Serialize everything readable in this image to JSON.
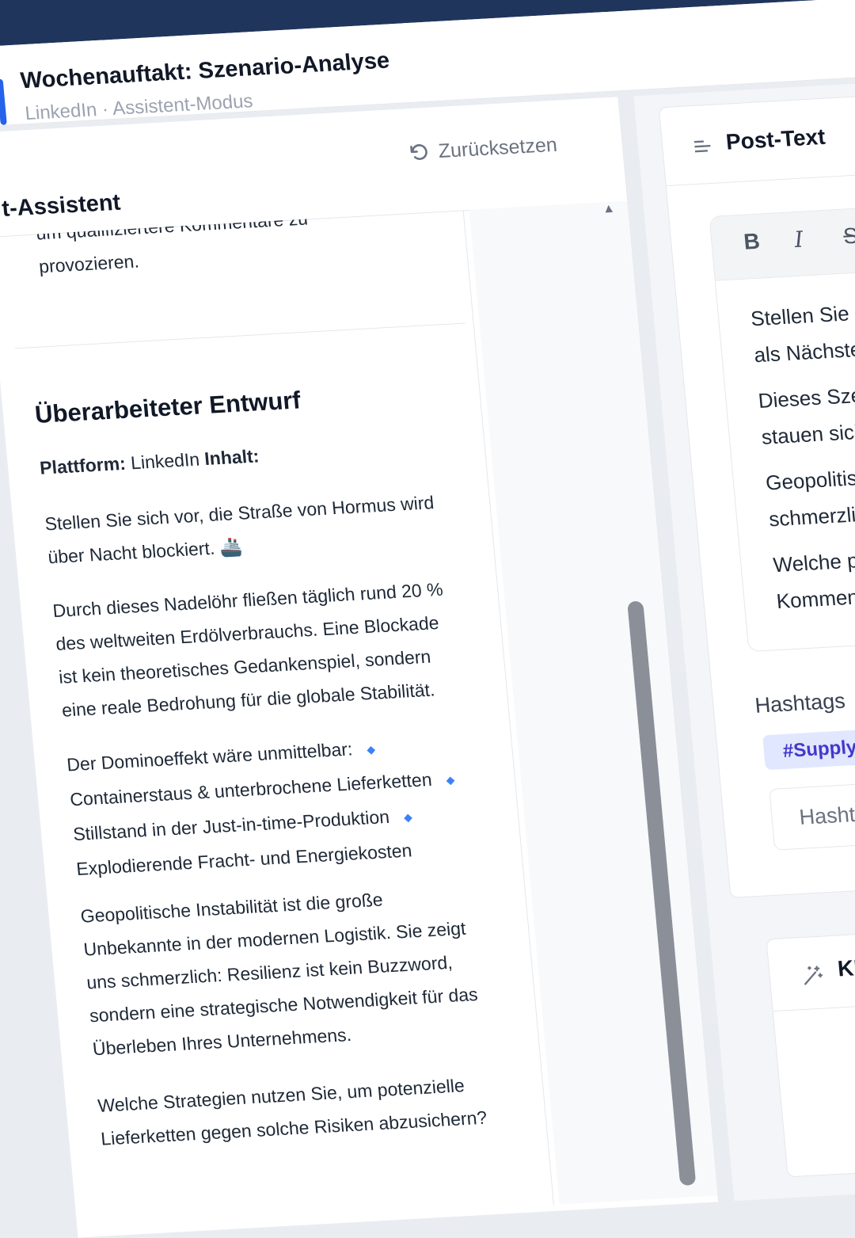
{
  "header": {
    "title": "Wochenauftakt: Szenario-Analyse",
    "subtitle": "LinkedIn · Assistent-Modus"
  },
  "assistant": {
    "title": "t-Assistent",
    "reset_label": "Zurücksetzen",
    "previous_text": [
      "um qualifiziertere Kommentare zu",
      "provozieren."
    ],
    "draft_title": "Überarbeiteter Entwurf",
    "platform_label": "Plattform:",
    "platform_value": "LinkedIn",
    "content_label": "Inhalt:",
    "paragraphs": {
      "p1": [
        "Stellen Sie sich vor, die Straße von Hormus wird",
        "über Nacht blockiert. 🚢"
      ],
      "p2": [
        "Durch dieses Nadelöhr fließen täglich rund 20 %",
        "des weltweiten Erdölverbrauchs. Eine Blockade",
        "ist kein theoretisches Gedankenspiel, sondern",
        "eine reale Bedrohung für die globale Stabilität."
      ],
      "p3": [
        "Der Dominoeffekt wäre unmittelbar:",
        "Containerstaus & unterbrochene Lieferketten",
        "Stillstand in der Just-in-time-Produktion",
        "Explodierende Fracht- und Energiekosten"
      ],
      "p4": [
        "Geopolitische Instabilität ist die große",
        "Unbekannte in der modernen Logistik. Sie zeigt",
        "uns schmerzlich: Resilienz ist kein Buzzword,",
        "sondern eine strategische Notwendigkeit für das",
        "Überleben Ihres Unternehmens."
      ],
      "p5": [
        "Welche Strategien nutzen Sie, um potenzielle",
        "Lieferketten gegen solche Risiken abzusichern?"
      ]
    }
  },
  "editor": {
    "card_title": "Post-Text",
    "toolbar": {
      "bold": "B",
      "italic": "I",
      "strike": "S"
    },
    "lines": [
      "Stellen Sie si",
      "als Nächstes",
      "Dieses Szen",
      "stauen sich",
      "Geopolitisc",
      "schmerzlic",
      "Welche po",
      "Kommenta"
    ]
  },
  "hashtags": {
    "label": "Hashtags",
    "chip": "#SupplyCha",
    "input_placeholder": "Hashtag"
  },
  "variants": {
    "title": "KI-Vari"
  },
  "colors": {
    "accent": "#2563eb",
    "topbar": "#1f355c",
    "chip_bg": "#e0e7ff",
    "chip_text": "#4338ca",
    "bullet": "#3b82f6"
  }
}
